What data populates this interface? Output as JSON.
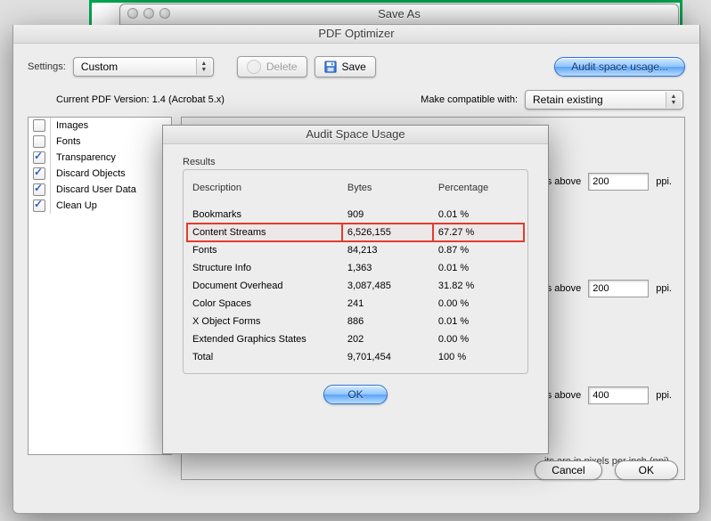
{
  "saveas": {
    "title": "Save As"
  },
  "optimizer": {
    "title": "PDF Optimizer",
    "settings_label": "Settings:",
    "settings_value": "Custom",
    "delete_label": "Delete",
    "save_label": "Save",
    "audit_button": "Audit space usage...",
    "version_label": "Current PDF Version:",
    "version_value": "1.4 (Acrobat 5.x)",
    "compat_label": "Make compatible with:",
    "compat_value": "Retain existing",
    "checklist": [
      {
        "label": "Images",
        "checked": false
      },
      {
        "label": "Fonts",
        "checked": false
      },
      {
        "label": "Transparency",
        "checked": true
      },
      {
        "label": "Discard Objects",
        "checked": true
      },
      {
        "label": "Discard User Data",
        "checked": true
      },
      {
        "label": "Clean Up",
        "checked": true
      }
    ],
    "pane": {
      "row_suffix": "ages above",
      "ppi_unit": "ppi.",
      "values": [
        "200",
        "200",
        "400"
      ],
      "note": "its are in pixels per inch (ppi)."
    },
    "footer": {
      "cancel": "Cancel",
      "ok": "OK"
    }
  },
  "audit": {
    "title": "Audit Space Usage",
    "group_label": "Results",
    "headers": {
      "desc": "Description",
      "bytes": "Bytes",
      "pct": "Percentage"
    },
    "rows": [
      {
        "desc": "Bookmarks",
        "bytes": "909",
        "pct": "0.01 %",
        "hl": false
      },
      {
        "desc": "Content Streams",
        "bytes": "6,526,155",
        "pct": "67.27 %",
        "hl": true
      },
      {
        "desc": "Fonts",
        "bytes": "84,213",
        "pct": "0.87 %",
        "hl": false
      },
      {
        "desc": "Structure Info",
        "bytes": "1,363",
        "pct": "0.01 %",
        "hl": false
      },
      {
        "desc": "Document Overhead",
        "bytes": "3,087,485",
        "pct": "31.82 %",
        "hl": false
      },
      {
        "desc": "Color Spaces",
        "bytes": "241",
        "pct": "0.00 %",
        "hl": false
      },
      {
        "desc": "X Object Forms",
        "bytes": "886",
        "pct": "0.01 %",
        "hl": false
      },
      {
        "desc": "Extended Graphics States",
        "bytes": "202",
        "pct": "0.00 %",
        "hl": false
      },
      {
        "desc": "Total",
        "bytes": "9,701,454",
        "pct": "100 %",
        "hl": false
      }
    ],
    "ok": "OK"
  }
}
